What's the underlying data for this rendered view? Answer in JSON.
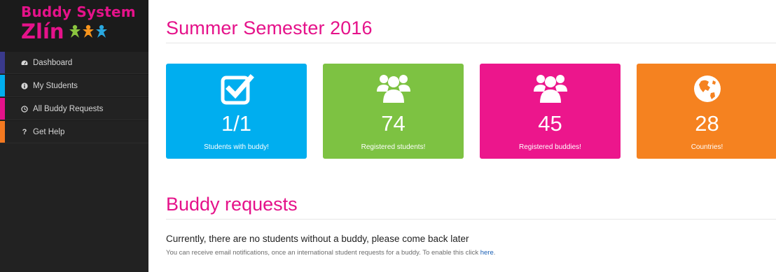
{
  "brand": {
    "line1": "Buddy System",
    "line2": "Zlín",
    "color": "#e5128a",
    "figure_colors": [
      "#8bc53f",
      "#f7941d",
      "#29a8e0"
    ]
  },
  "sidebar": {
    "items": [
      {
        "label": "Dashboard",
        "icon": "dashboard-icon",
        "accent": "#3a3a8c"
      },
      {
        "label": "My Students",
        "icon": "info-icon",
        "accent": "#00aeef"
      },
      {
        "label": "All Buddy Requests",
        "icon": "clock-icon",
        "accent": "#e5128a"
      },
      {
        "label": "Get Help",
        "icon": "question-icon",
        "accent": "#f47920"
      }
    ]
  },
  "main": {
    "title": "Summer Semester 2016",
    "stats": [
      {
        "number": "1/1",
        "label": "Students with buddy!",
        "icon": "check-square-icon",
        "color": "#00aeef"
      },
      {
        "number": "74",
        "label": "Registered students!",
        "icon": "users-icon",
        "color": "#7dc242"
      },
      {
        "number": "45",
        "label": "Registered buddies!",
        "icon": "users-icon",
        "color": "#ec168c"
      },
      {
        "number": "28",
        "label": "Countries!",
        "icon": "globe-icon",
        "color": "#f58220"
      }
    ],
    "section_title": "Buddy requests",
    "notice": "Currently, there are no students without a buddy, please come back later",
    "hint_text": "You can receive email notifications, once an international student requests for a buddy. To enable this click",
    "hint_link": "here",
    "hint_end": "."
  }
}
